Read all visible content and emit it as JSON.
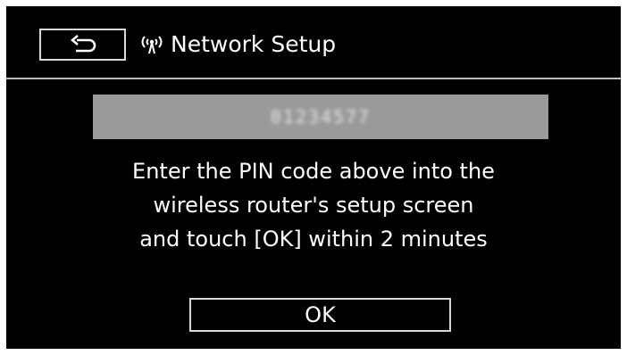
{
  "header": {
    "title": "Network Setup",
    "back_icon": "return-arrow-icon",
    "network_icon": "wireless-antenna-icon"
  },
  "pin": {
    "value": "01234577"
  },
  "message": {
    "lines": [
      "Enter the PIN code above into the",
      "wireless router's setup screen",
      "and touch [OK] within 2 minutes"
    ]
  },
  "actions": {
    "ok_label": "OK"
  },
  "colors": {
    "background": "#000000",
    "text": "#ffffff",
    "pin_box": "#9a9a9a",
    "border": "#d8d8d8"
  }
}
